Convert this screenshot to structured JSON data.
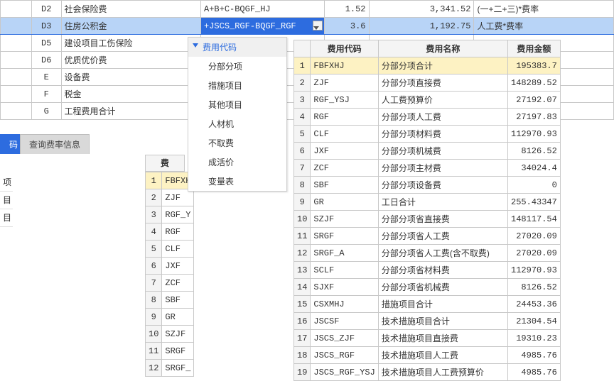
{
  "upper": {
    "rows": [
      {
        "b": "D2",
        "c": "社会保险费",
        "d": "A+B+C-BQGF_HJ",
        "e": "1.52",
        "f": "3,341.52",
        "g": "(一+二+三)*费率"
      },
      {
        "b": "D3",
        "c": "住房公积金",
        "d": "+JSCS_RGF-BQGF_RGF",
        "e": "3.6",
        "f": "1,192.75",
        "g": "人工费*费率",
        "selected": true,
        "editing": true
      },
      {
        "b": "D5",
        "c": "建设项目工伤保险",
        "d": "",
        "e": "",
        "f": "",
        "g": ""
      },
      {
        "b": "D6",
        "c": "优质优价费",
        "d": "",
        "e": "",
        "f": "",
        "g": ""
      },
      {
        "b": "E",
        "c": "设备费",
        "d": "",
        "e": "",
        "f": "",
        "g": ""
      },
      {
        "b": "F",
        "c": "税金",
        "d": "",
        "e": "",
        "f": "",
        "g": ""
      },
      {
        "b": "G",
        "c": "工程费用合计",
        "d": "",
        "e": "",
        "f": "",
        "g": ""
      }
    ]
  },
  "tabs": {
    "active": "码",
    "other": "查询费率信息"
  },
  "left_frag": [
    "项",
    "目",
    "目"
  ],
  "mini": {
    "header": "费",
    "rows": [
      "FBFXH",
      "ZJF",
      "RGF_Y",
      "RGF",
      "CLF",
      "JXF",
      "ZCF",
      "SBF",
      "GR",
      "SZJF",
      "SRGF",
      "SRGF_"
    ]
  },
  "dropdown": {
    "header": "费用代码",
    "options": [
      "分部分项",
      "措施项目",
      "其他项目",
      "人材机",
      "不取费",
      "成活价",
      "变量表"
    ]
  },
  "right": {
    "headers": {
      "code": "费用代码",
      "name": "费用名称",
      "amt": "费用金额"
    },
    "rows": [
      {
        "code": "FBFXHJ",
        "name": "分部分项合计",
        "amt": "195383.7"
      },
      {
        "code": "ZJF",
        "name": "分部分项直接费",
        "amt": "148289.52"
      },
      {
        "code": "RGF_YSJ",
        "name": "人工费预算价",
        "amt": "27192.07"
      },
      {
        "code": "RGF",
        "name": "分部分项人工费",
        "amt": "27197.83"
      },
      {
        "code": "CLF",
        "name": "分部分项材料费",
        "amt": "112970.93"
      },
      {
        "code": "JXF",
        "name": "分部分项机械费",
        "amt": "8126.52"
      },
      {
        "code": "ZCF",
        "name": "分部分项主材费",
        "amt": "34024.4"
      },
      {
        "code": "SBF",
        "name": "分部分项设备费",
        "amt": "0"
      },
      {
        "code": "GR",
        "name": "工日合计",
        "amt": "255.43347"
      },
      {
        "code": "SZJF",
        "name": "分部分项省直接费",
        "amt": "148117.54"
      },
      {
        "code": "SRGF",
        "name": "分部分项省人工费",
        "amt": "27020.09"
      },
      {
        "code": "SRGF_A",
        "name": "分部分项省人工费(含不取费)",
        "amt": "27020.09"
      },
      {
        "code": "SCLF",
        "name": "分部分项省材料费",
        "amt": "112970.93"
      },
      {
        "code": "SJXF",
        "name": "分部分项省机械费",
        "amt": "8126.52"
      },
      {
        "code": "CSXMHJ",
        "name": "措施项目合计",
        "amt": "24453.36"
      },
      {
        "code": "JSCSF",
        "name": "技术措施项目合计",
        "amt": "21304.54"
      },
      {
        "code": "JSCS_ZJF",
        "name": "技术措施项目直接费",
        "amt": "19310.23"
      },
      {
        "code": "JSCS_RGF",
        "name": "技术措施项目人工费",
        "amt": "4985.76"
      },
      {
        "code": "JSCS_RGF_YSJ",
        "name": "技术措施项目人工费预算价",
        "amt": "4985.76"
      }
    ]
  }
}
